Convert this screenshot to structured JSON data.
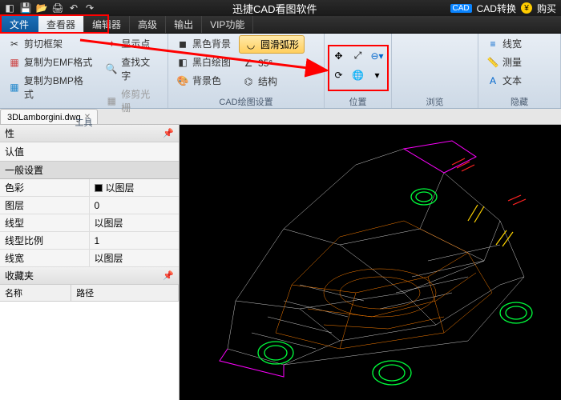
{
  "title": "迅捷CAD看图软件",
  "titlebar_right": {
    "cad_badge": "CAD",
    "convert": "CAD转换",
    "buy": "购买"
  },
  "menu": {
    "file": "文件",
    "tabs": [
      "查看器",
      "编辑器",
      "高级",
      "输出",
      "VIP功能"
    ],
    "active": 0
  },
  "ribbon": {
    "group_tool": {
      "label": "工具",
      "cut_frame": "剪切框架",
      "copy_emf": "复制为EMF格式",
      "copy_bmp": "复制为BMP格式",
      "show_point": "显示点",
      "find_text": "查找文字",
      "fix_grid": "修剪光栅"
    },
    "group_draw": {
      "label": "CAD绘图设置",
      "black_bg": "黑色背景",
      "bw_draw": "黑白绘图",
      "bg_color": "背景色",
      "smooth_arc": "圆滑弧形",
      "angle": "35°",
      "struct": "结构"
    },
    "group_pos": {
      "label": "位置"
    },
    "group_view": {
      "label": "浏览"
    },
    "group_hide": {
      "label": "隐藏",
      "line_w": "线宽",
      "measure": "测量",
      "text": "文本"
    }
  },
  "doc_tab": "3DLamborgini.dwg",
  "props": {
    "title": "性",
    "default": "认值",
    "section": "一般设置",
    "rows": [
      {
        "name": "色彩",
        "val": "以图层",
        "swatch": true
      },
      {
        "name": "图层",
        "val": "0"
      },
      {
        "name": "线型",
        "val": "以图层"
      },
      {
        "name": "线型比例",
        "val": "1"
      },
      {
        "name": "线宽",
        "val": "以图层"
      }
    ]
  },
  "favorites": {
    "title": "收藏夹",
    "col1": "名称",
    "col2": "路径"
  }
}
